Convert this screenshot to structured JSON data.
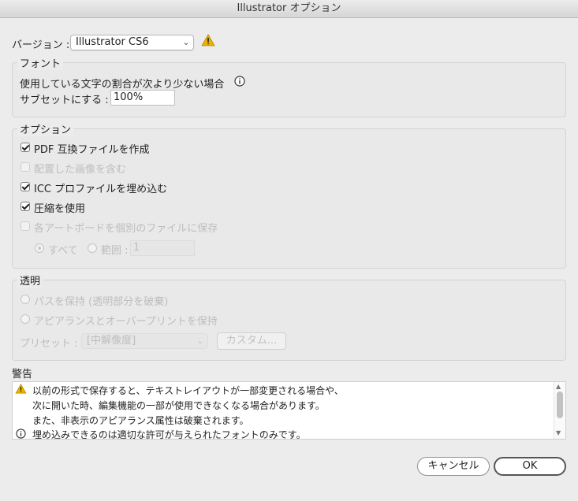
{
  "window": {
    "title": "Illustrator オプション"
  },
  "version": {
    "label": "バージョン :",
    "selected": "Illustrator CS6"
  },
  "font_section": {
    "legend": "フォント",
    "line1": "使用している文字の割合が次より少ない場合",
    "line2": "サブセットにする :",
    "value": "100%"
  },
  "options_section": {
    "legend": "オプション",
    "items": [
      {
        "label": "PDF 互換ファイルを作成",
        "checked": true,
        "enabled": true
      },
      {
        "label": "配置した画像を含む",
        "checked": false,
        "enabled": false
      },
      {
        "label": "ICC プロファイルを埋め込む",
        "checked": true,
        "enabled": true
      },
      {
        "label": "圧縮を使用",
        "checked": true,
        "enabled": true
      },
      {
        "label": "各アートボードを個別のファイルに保存",
        "checked": false,
        "enabled": false
      }
    ],
    "radio_all": "すべて",
    "radio_range": "範囲 :",
    "range_value": "1"
  },
  "transparency_section": {
    "legend": "透明",
    "radio1": "パスを保持 (透明部分を破棄)",
    "radio2": "アピアランスとオーバープリントを保持",
    "preset_label": "プリセット :",
    "preset_value": "[中解像度]",
    "custom_button": "カスタム..."
  },
  "warnings": {
    "legend": "警告",
    "lines": [
      "以前の形式で保存すると、テキストレイアウトが一部変更される場合や、",
      "次に開いた時、編集機能の一部が使用できなくなる場合があります。",
      "また、非表示のアピアランス属性は破棄されます。",
      "埋め込みできるのは適切な許可が与えられたフォントのみです。"
    ]
  },
  "buttons": {
    "cancel": "キャンセル",
    "ok": "OK"
  },
  "colors": {
    "warning_yellow": "#e8b400",
    "background": "#ececec"
  }
}
